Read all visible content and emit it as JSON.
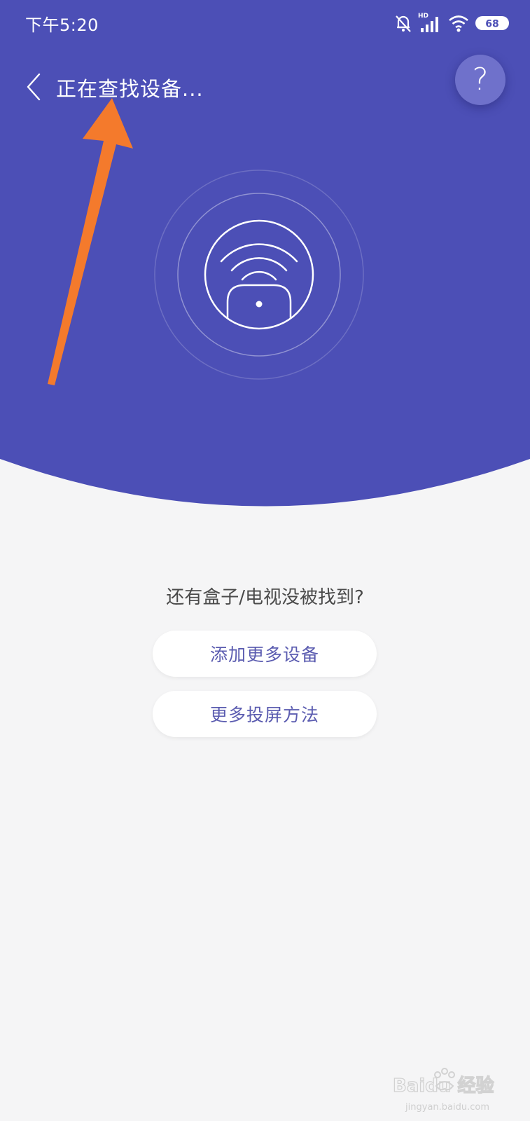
{
  "status_bar": {
    "time": "下午5:20",
    "network_label": "HD",
    "battery": "68",
    "icons": [
      "mute-bell-icon",
      "signal-icon",
      "wifi-icon",
      "battery-icon"
    ]
  },
  "header": {
    "title": "正在查找设备...",
    "back_icon": "chevron-left-icon",
    "help_label": "?"
  },
  "scan": {
    "icon": "tv-cast-icon"
  },
  "content": {
    "prompt": "还有盒子/电视没被找到?",
    "add_device_button": "添加更多设备",
    "more_cast_button": "更多投屏方法"
  },
  "watermark": {
    "logo_text": "Baidu 经验",
    "url": "jingyan.baidu.com"
  },
  "colors": {
    "hero_bg": "#4c4fb6",
    "page_bg": "#f5f5f6",
    "button_text": "#5b5cb0",
    "annotation_arrow": "#f47a2c"
  }
}
